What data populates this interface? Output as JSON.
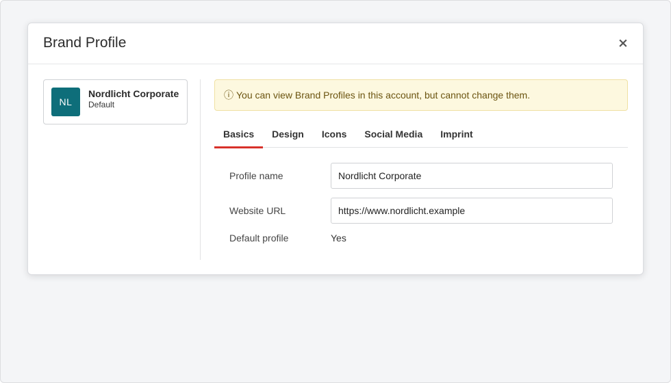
{
  "modal": {
    "title": "Brand Profile",
    "close_label": "×"
  },
  "sidebar": {
    "profiles": [
      {
        "initials": "NL",
        "name": "Nordlicht Corporate",
        "subtitle": "Default",
        "avatar_color": "#0e6e7a"
      }
    ]
  },
  "alert": {
    "icon": "ⓘ",
    "text": "You can view Brand Profiles in this account, but cannot change them."
  },
  "tabs": [
    {
      "label": "Basics",
      "active": true
    },
    {
      "label": "Design",
      "active": false
    },
    {
      "label": "Icons",
      "active": false
    },
    {
      "label": "Social Media",
      "active": false
    },
    {
      "label": "Imprint",
      "active": false
    }
  ],
  "form": {
    "profile_name": {
      "label": "Profile name",
      "value": "Nordlicht Corporate"
    },
    "website_url": {
      "label": "Website URL",
      "value": "https://www.nordlicht.example"
    },
    "default_profile": {
      "label": "Default profile",
      "value": "Yes"
    }
  },
  "colors": {
    "accent_tab": "#d8312a",
    "alert_bg": "#fdf8df",
    "avatar": "#0e6e7a"
  }
}
